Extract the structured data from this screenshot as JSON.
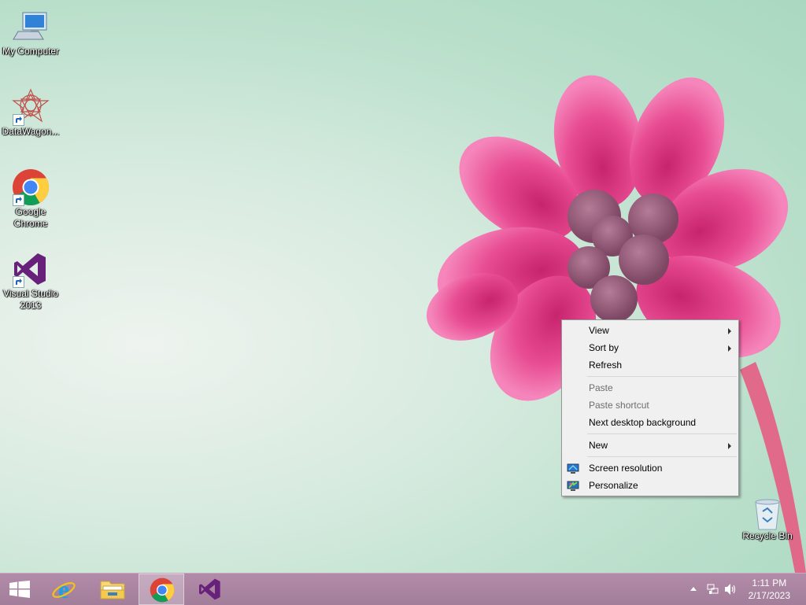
{
  "desktop_icons": [
    {
      "label_lines": [
        "My Computer"
      ],
      "icon": "computer-icon"
    },
    {
      "label_lines": [
        "DataWagon..."
      ],
      "icon": "datawagon-icon"
    },
    {
      "label_lines": [
        "Google",
        "Chrome"
      ],
      "icon": "chrome-icon"
    },
    {
      "label_lines": [
        "Visual Studio",
        "2013"
      ],
      "icon": "visual-studio-icon"
    }
  ],
  "recycle_bin": {
    "label": "Recycle Bin",
    "icon": "recycle-bin-icon"
  },
  "context_menu": {
    "items": [
      {
        "label": "View",
        "submenu": true,
        "disabled": false
      },
      {
        "label": "Sort by",
        "submenu": true,
        "disabled": false
      },
      {
        "label": "Refresh",
        "submenu": false,
        "disabled": false
      },
      {
        "label": "Paste",
        "submenu": false,
        "disabled": true
      },
      {
        "label": "Paste shortcut",
        "submenu": false,
        "disabled": true
      },
      {
        "label": "Next desktop background",
        "submenu": false,
        "disabled": false
      },
      {
        "label": "New",
        "submenu": true,
        "disabled": false
      },
      {
        "label": "Screen resolution",
        "submenu": false,
        "disabled": false,
        "icon": "monitor-icon"
      },
      {
        "label": "Personalize",
        "submenu": false,
        "disabled": false,
        "icon": "personalize-icon"
      }
    ]
  },
  "taskbar": {
    "buttons": [
      {
        "icon": "start-icon",
        "active": false
      },
      {
        "icon": "internet-explorer-icon",
        "active": false
      },
      {
        "icon": "file-explorer-icon",
        "active": false
      },
      {
        "icon": "chrome-icon",
        "active": true
      },
      {
        "icon": "visual-studio-icon",
        "active": false
      }
    ],
    "tray": {
      "icons": [
        "show-hidden-icons-icon",
        "network-icon",
        "volume-icon"
      ]
    },
    "clock": {
      "time": "1:11 PM",
      "date": "2/17/2023"
    }
  },
  "colors": {
    "taskbar": "#a8839f",
    "flower": "#e8488f",
    "menu_bg": "#f0f0f0"
  }
}
